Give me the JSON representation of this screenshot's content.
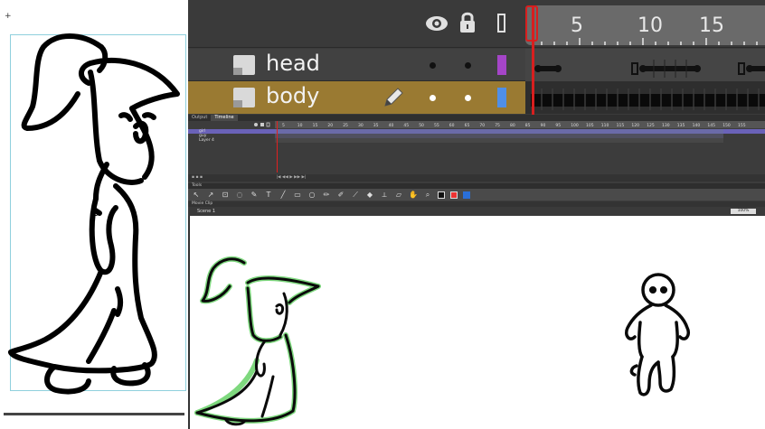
{
  "left_panel": {
    "plus_marker": "+"
  },
  "zoomed_timeline": {
    "ruler_numbers": [
      "5",
      "10",
      "15"
    ],
    "layers": [
      {
        "name": "head",
        "color": "#a545c8",
        "edit_icon": "",
        "selected": false
      },
      {
        "name": "body",
        "color": "#4f8fe8",
        "edit_icon": "pencil-icon",
        "selected": true
      }
    ],
    "header_icons": [
      "eye-icon",
      "lock-icon",
      "outline-icon"
    ]
  },
  "flash_ui": {
    "tabs": [
      "Output",
      "Timeline"
    ],
    "active_tab": "Timeline",
    "ruler_labels": [
      "5",
      "10",
      "15",
      "20",
      "25",
      "30",
      "35",
      "40",
      "45",
      "50",
      "55",
      "60",
      "65",
      "70",
      "75",
      "80",
      "85",
      "90",
      "95",
      "100",
      "105",
      "110",
      "115",
      "120",
      "125",
      "130",
      "135",
      "140",
      "145",
      "150",
      "155"
    ],
    "layers": [
      {
        "name": "girl",
        "color": "#6a5acd",
        "selected": true
      },
      {
        "name": "guy",
        "color": "#c8913a",
        "selected": false
      },
      {
        "name": "Layer 4",
        "color": "#6aa84f",
        "selected": false
      }
    ],
    "tools_label": "Tools",
    "edit_label": "Movie Clip",
    "scene_label": "Scene 1",
    "zoom_value": "100%"
  }
}
